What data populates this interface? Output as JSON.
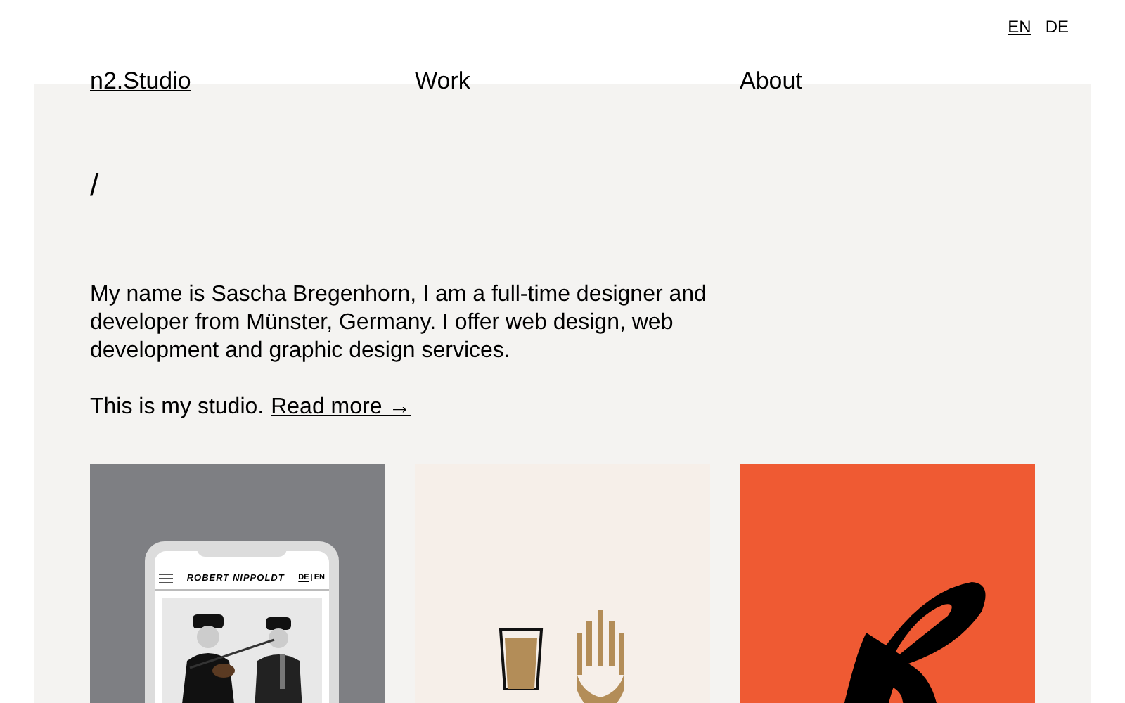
{
  "languages": [
    {
      "label": "EN",
      "selected": true
    },
    {
      "label": "DE",
      "selected": false
    }
  ],
  "nav": {
    "brand": "n2.Studio",
    "links": [
      "Work",
      "About"
    ]
  },
  "intro": {
    "mark": "/",
    "text": "My name is Sascha Bregenhorn, I am a full-time designer and developer from Münster, Germany. I offer web design, web development and graphic design services.",
    "studio": "This is my studio.",
    "link": "Read more →"
  },
  "projects": [
    {
      "kind": "phone-mockup",
      "title": "ROBERT NIPPOLDT",
      "languages": [
        {
          "label": "DE",
          "selected": true
        },
        {
          "label": "EN",
          "selected": false
        }
      ],
      "separator": "|"
    },
    {
      "kind": "beer-logo"
    },
    {
      "kind": "brush-logo"
    }
  ]
}
